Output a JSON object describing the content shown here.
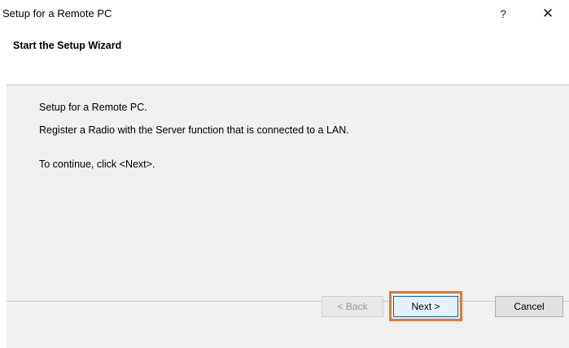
{
  "window": {
    "title": "Setup for a Remote PC",
    "help_label": "?",
    "close_label": "✕"
  },
  "header": {
    "title": "Start the Setup Wizard"
  },
  "body": {
    "line1": "Setup for a Remote PC.",
    "line2": "Register a Radio with the Server function that is connected to a LAN.",
    "line3": "To continue, click <Next>."
  },
  "buttons": {
    "back": "< Back",
    "next": "Next >",
    "cancel": "Cancel"
  },
  "colors": {
    "highlight": "#e07a2d",
    "body_bg": "#f0f0f0"
  }
}
